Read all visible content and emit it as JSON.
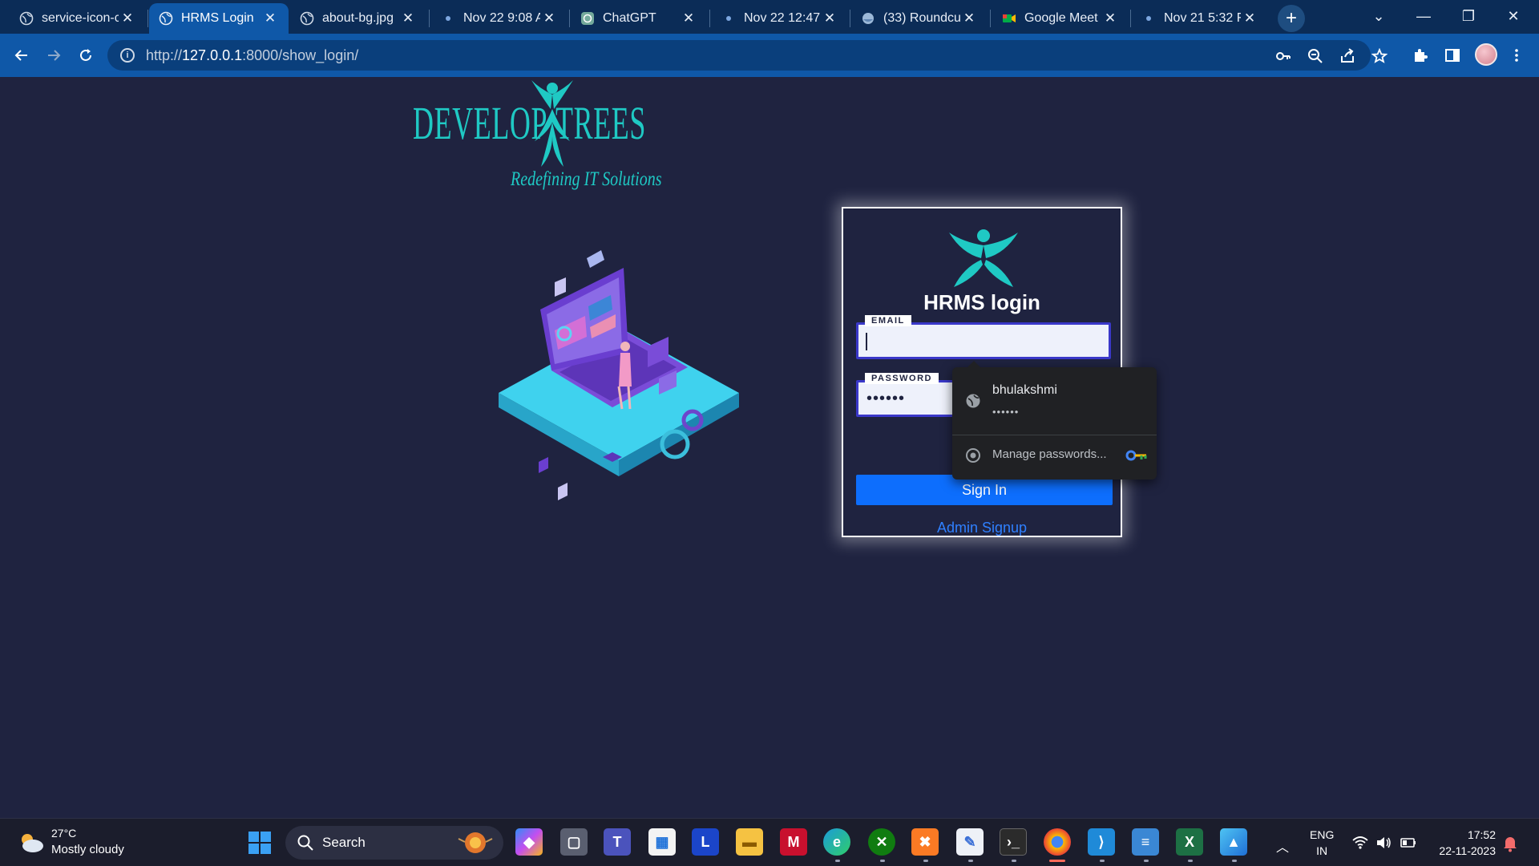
{
  "browser": {
    "tabs": [
      {
        "label": "service-icon-c",
        "favicon": "globe-icon",
        "active": false
      },
      {
        "label": "HRMS Login",
        "favicon": "globe-icon",
        "active": true
      },
      {
        "label": "about-bg.jpg",
        "favicon": "globe-icon",
        "active": false
      },
      {
        "label": "Nov 22 9:08 A",
        "favicon": "dot-icon",
        "active": false
      },
      {
        "label": "ChatGPT",
        "favicon": "chatgpt-icon",
        "active": false
      },
      {
        "label": "Nov 22 12:47",
        "favicon": "dot-icon",
        "active": false
      },
      {
        "label": "(33) Roundcu",
        "favicon": "roundcube-icon",
        "active": false
      },
      {
        "label": "Google Meet",
        "favicon": "meet-icon",
        "active": false
      },
      {
        "label": "Nov 21 5:32 F",
        "favicon": "dot-icon",
        "active": false
      }
    ],
    "url_prefix": "http://",
    "url_host": "127.0.0.1",
    "url_rest": ":8000/show_login/",
    "toolbar_icons": [
      "key-icon",
      "zoom-icon",
      "share-icon",
      "star-icon",
      "extensions-icon",
      "side-panel-icon",
      "profile-avatar",
      "menu-icon"
    ]
  },
  "page": {
    "logo": {
      "left_word": "DEVELOP",
      "right_word": "TREES",
      "tagline": "Redefining IT Solutions"
    },
    "login": {
      "title": "HRMS login",
      "email_label": "EMAIL",
      "email_value": "",
      "password_label": "PASSWORD",
      "password_value": "••••••",
      "signin_label": "Sign In",
      "signup_label": "Admin Signup"
    },
    "autofill": {
      "username": "bhulakshmi",
      "password_mask": "••••••",
      "manage_label": "Manage passwords..."
    }
  },
  "taskbar": {
    "weather_temp": "27°C",
    "weather_desc": "Mostly cloudy",
    "search_label": "Search",
    "lang_top": "ENG",
    "lang_bottom": "IN",
    "time": "17:52",
    "date": "22-11-2023",
    "apps": [
      "copilot-icon",
      "task-view-icon",
      "teams-icon",
      "store-icon",
      "l-app-icon",
      "file-explorer-icon",
      "mcafee-icon",
      "edge-icon",
      "xbox-icon",
      "xampp-icon",
      "notepad-doc-icon",
      "terminal-icon",
      "chrome-icon",
      "vscode-icon",
      "notepad-icon",
      "excel-icon",
      "photos-icon"
    ]
  },
  "colors": {
    "page_bg": "#1f2340",
    "brand_teal": "#1fc9c4",
    "button_blue": "#0d6efd",
    "tab_active": "#0f58a8"
  }
}
